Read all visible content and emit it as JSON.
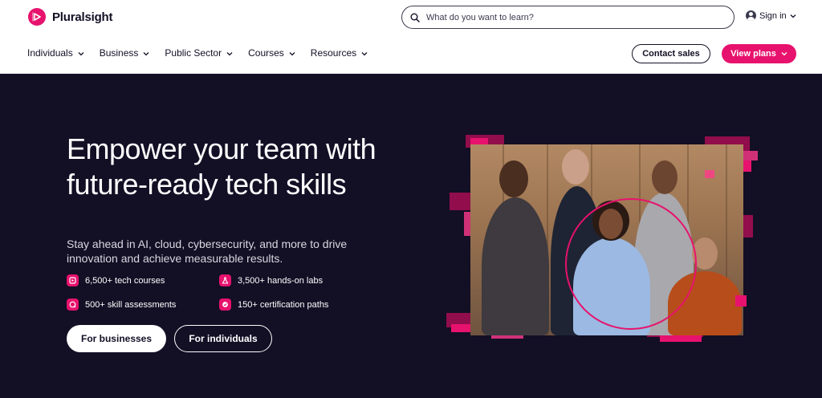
{
  "brand": {
    "name": "Pluralsight",
    "accent": "#e7126d",
    "dark": "#130f25"
  },
  "search": {
    "placeholder": "What do you want to learn?",
    "icon": "search-icon"
  },
  "account": {
    "signin_label": "Sign in",
    "icon": "user-icon"
  },
  "nav": {
    "items": [
      {
        "label": "Individuals"
      },
      {
        "label": "Business"
      },
      {
        "label": "Public Sector"
      },
      {
        "label": "Courses"
      },
      {
        "label": "Resources"
      }
    ]
  },
  "header_actions": {
    "contact_label": "Contact sales",
    "view_plans_label": "View plans"
  },
  "hero": {
    "title": "Empower your team with future-ready tech skills",
    "subtitle": "Stay ahead in AI, cloud, cybersecurity, and more to drive innovation and achieve measurable results.",
    "features": [
      {
        "label": "6,500+ tech courses",
        "icon": "courses-icon"
      },
      {
        "label": "3,500+ hands-on labs",
        "icon": "lab-flask-icon"
      },
      {
        "label": "500+ skill assessments",
        "icon": "assessment-icon"
      },
      {
        "label": "150+ certification paths",
        "icon": "certification-icon"
      }
    ],
    "cta_business": "For businesses",
    "cta_individuals": "For individuals"
  }
}
